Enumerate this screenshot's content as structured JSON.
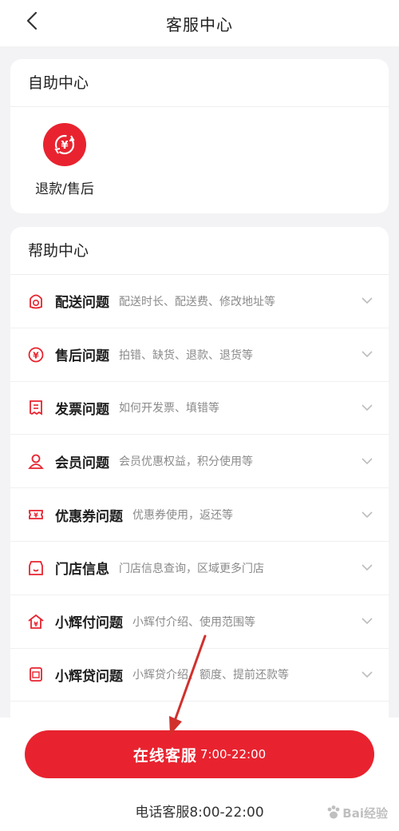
{
  "header": {
    "title": "客服中心"
  },
  "self_service": {
    "title": "自助中心",
    "items": [
      {
        "label": "退款/售后",
        "icon": "refund-icon"
      }
    ]
  },
  "help": {
    "title": "帮助中心",
    "items": [
      {
        "name": "配送问题",
        "desc": "配送时长、配送费、修改地址等",
        "icon": "delivery-icon"
      },
      {
        "name": "售后问题",
        "desc": "拍错、缺货、退款、退货等",
        "icon": "yen-icon"
      },
      {
        "name": "发票问题",
        "desc": "如何开发票、填错等",
        "icon": "invoice-icon"
      },
      {
        "name": "会员问题",
        "desc": "会员优惠权益，积分使用等",
        "icon": "member-icon"
      },
      {
        "name": "优惠券问题",
        "desc": "优惠券使用，返还等",
        "icon": "coupon-icon"
      },
      {
        "name": "门店信息",
        "desc": "门店信息查询，区域更多门店",
        "icon": "store-icon"
      },
      {
        "name": "小辉付问题",
        "desc": "小辉付介绍、使用范围等",
        "icon": "pay-icon"
      },
      {
        "name": "小辉贷问题",
        "desc": "小辉贷介绍、额度、提前还款等",
        "icon": "loan-icon"
      }
    ]
  },
  "bottom": {
    "online_label": "在线客服",
    "online_hours": "7:00-22:00",
    "phone_line": "电话客服8:00-22:00"
  },
  "watermark": {
    "text": "Bai经验"
  },
  "colors": {
    "accent": "#e8232f",
    "background": "#f3f3f5",
    "annotation_arrow": "#d0312d"
  }
}
